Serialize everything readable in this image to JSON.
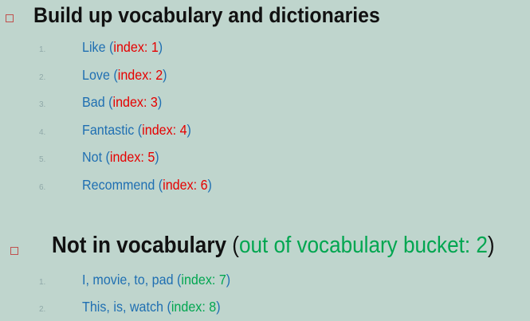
{
  "section1": {
    "title": "Build up vocabulary and dictionaries",
    "items": [
      {
        "num": "1.",
        "word": "Like",
        "index_label": "index: 1"
      },
      {
        "num": "2.",
        "word": "Love",
        "index_label": "index: 2"
      },
      {
        "num": "3.",
        "word": "Bad",
        "index_label": "index: 3"
      },
      {
        "num": "4.",
        "word": "Fantastic",
        "index_label": "index: 4"
      },
      {
        "num": "5.",
        "word": "Not",
        "index_label": "index: 5"
      },
      {
        "num": "6.",
        "word": "Recommend",
        "index_label": "index: 6"
      }
    ]
  },
  "section2": {
    "title": "Not in vocabulary",
    "bucket_label": "out of vocabulary bucket: 2",
    "items": [
      {
        "num": "1.",
        "word": "I, movie, to, pad",
        "index_label": "index: 7"
      },
      {
        "num": "2.",
        "word": "This, is, watch",
        "index_label": "index: 8"
      }
    ]
  },
  "colors": {
    "background": "#bfd5cd",
    "bullet": "#c0504d",
    "word": "#1f6fb2",
    "index_red": "#e60000",
    "index_green": "#00a650"
  },
  "icons": [
    "square-bullet-icon",
    "square-bullet-icon"
  ]
}
